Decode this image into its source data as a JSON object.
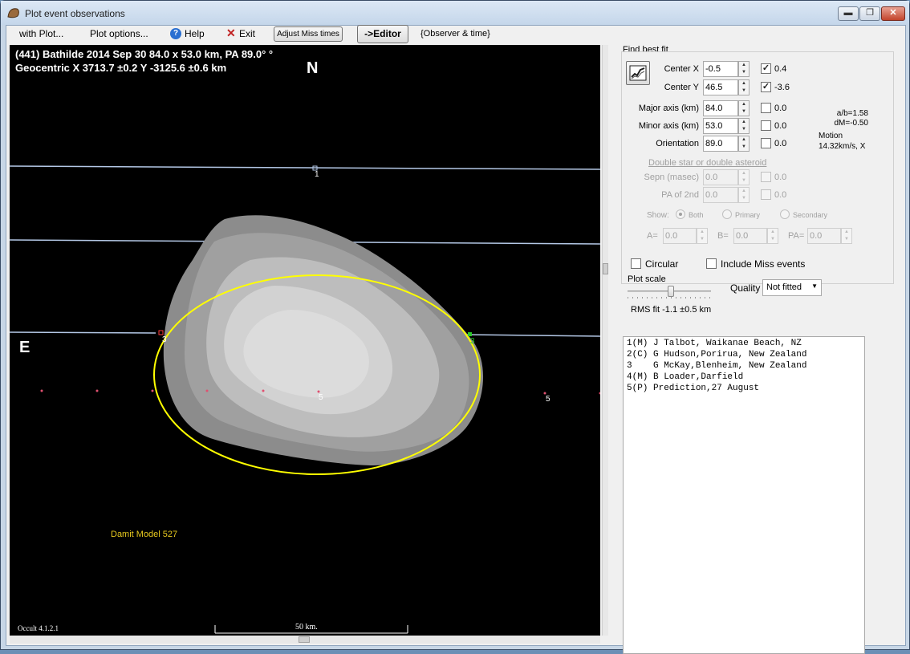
{
  "window": {
    "title": "Plot event observations",
    "controls": {
      "minimize": "▬",
      "maximize": "❐",
      "close": "✕"
    }
  },
  "menu": {
    "with_plot": "with Plot...",
    "plot_options": "Plot options...",
    "help": "Help",
    "exit": "Exit",
    "adjust_miss_times": "Adjust Miss times",
    "editor": "->Editor",
    "observer_time": "{Observer & time}"
  },
  "plot": {
    "header_line1": "(441) Bathilde  2014 Sep 30   84.0 x 53.0 km,  PA 89.0° °",
    "header_line2": "Geocentric  X  3713.7 ±0.2  Y -3125.6 ±0.6 km",
    "north": "N",
    "east": "E",
    "chord_labels": [
      "1",
      "3",
      "3",
      "5",
      "5"
    ],
    "model_label": "Damit Model 527",
    "version": "Occult 4.1.2.1",
    "scale_label": "50 km.",
    "colors": {
      "background": "#000000",
      "ellipse": "#ffff00",
      "chord": "#b4c8e6",
      "model_label": "#e6c81e"
    }
  },
  "fit": {
    "group_title": "Find best fit",
    "fit_icon": "best-fit-icon",
    "center_x": {
      "label": "Center X",
      "value": "-0.5",
      "checked": true,
      "offset": "0.4"
    },
    "center_y": {
      "label": "Center Y",
      "value": "46.5",
      "checked": true,
      "offset": "-3.6"
    },
    "major_axis": {
      "label": "Major axis (km)",
      "value": "84.0",
      "checked": false,
      "offset": "0.0"
    },
    "minor_axis": {
      "label": "Minor axis (km)",
      "value": "53.0",
      "checked": false,
      "offset": "0.0"
    },
    "orientation": {
      "label": "Orientation",
      "value": "89.0",
      "checked": false,
      "offset": "0.0"
    },
    "ratio_ab": "a/b=1.58",
    "dm": "dM=-0.50",
    "motion_label": "Motion",
    "motion_value": "14.32km/s, X",
    "double_title": "Double star  or  double asteroid",
    "sepn": {
      "label": "Sepn (masec)",
      "value": "0.0",
      "offset": "0.0"
    },
    "pa2nd": {
      "label": "PA of 2nd",
      "value": "0.0",
      "offset": "0.0"
    },
    "show_label": "Show:",
    "show_options": [
      "Both",
      "Primary",
      "Secondary"
    ],
    "a_label": "A=",
    "a_value": "0.0",
    "b_label": "B=",
    "b_value": "0.0",
    "pa_label": "PA=",
    "pa_value": "0.0"
  },
  "options": {
    "circular": "Circular",
    "include_miss": "Include Miss events",
    "plot_scale": "Plot scale",
    "quality_label": "Quality",
    "quality_value": "Not fitted",
    "rms": "RMS fit -1.1 ±0.5 km"
  },
  "observers": [
    "1(M) J Talbot, Waikanae Beach, NZ",
    "2(C) G Hudson,Porirua, New Zealand",
    "3    G McKay,Blenheim, New Zealand",
    "4(M) B Loader,Darfield",
    "5(P) Prediction,27 August"
  ]
}
